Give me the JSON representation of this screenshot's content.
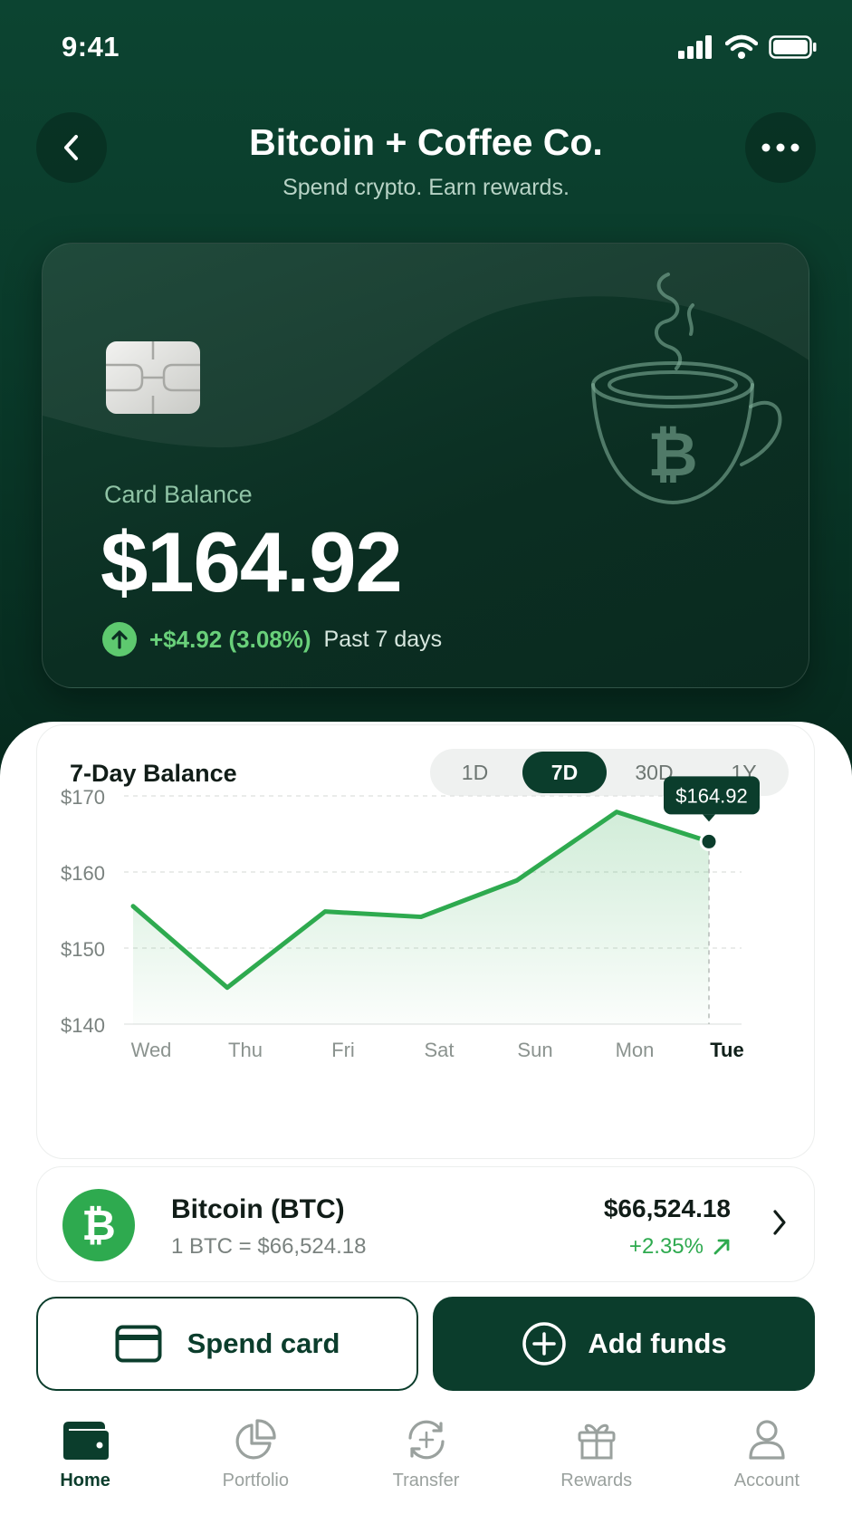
{
  "status_bar": {
    "time": "9:41"
  },
  "header": {
    "title": "Bitcoin + Coffee Co.",
    "subtitle": "Spend crypto. Earn rewards."
  },
  "card": {
    "label": "Card Balance",
    "balance": "$164.92",
    "change": "+$4.92 (3.08%)",
    "period": "Past 7 days"
  },
  "chart_panel": {
    "title": "7-Day Balance",
    "ranges": [
      "1D",
      "7D",
      "30D",
      "1Y"
    ],
    "active_range": "7D",
    "current_tooltip": "$164.92"
  },
  "chart_data": {
    "type": "area",
    "x": [
      "Wed",
      "Thu",
      "Fri",
      "Sat",
      "Sun",
      "Mon",
      "Tue"
    ],
    "values": [
      155.5,
      144.8,
      154.8,
      154.1,
      158.9,
      167.9,
      164.0
    ],
    "y_ticks": [
      "$170",
      "$160",
      "$150",
      "$140"
    ],
    "y_tick_values": [
      170,
      160,
      150,
      140
    ],
    "ylim": [
      140,
      170
    ],
    "highlight_label": "Tue",
    "grid": "horizontal dashed",
    "colors": {
      "line": "#2eaa4f",
      "fill": "#2eaa4f",
      "highlight": "#0b3d2c"
    }
  },
  "asset": {
    "name": "Bitcoin (BTC)",
    "rate": "1 BTC = $66,524.18",
    "price": "$66,524.18",
    "change": "+2.35%",
    "icon": "bitcoin-icon"
  },
  "actions": {
    "spend_label": "Spend card",
    "add_label": "Add funds"
  },
  "nav": {
    "items": [
      {
        "label": "Home",
        "icon": "wallet-icon"
      },
      {
        "label": "Portfolio",
        "icon": "pie-chart-icon"
      },
      {
        "label": "Transfer",
        "icon": "transfer-icon"
      },
      {
        "label": "Rewards",
        "icon": "gift-icon"
      },
      {
        "label": "Account",
        "icon": "user-icon"
      }
    ],
    "active": "Home"
  },
  "colors": {
    "brand_dark": "#0b3d2c",
    "accent_green": "#2eaa4f",
    "positive": "#69d07a"
  }
}
